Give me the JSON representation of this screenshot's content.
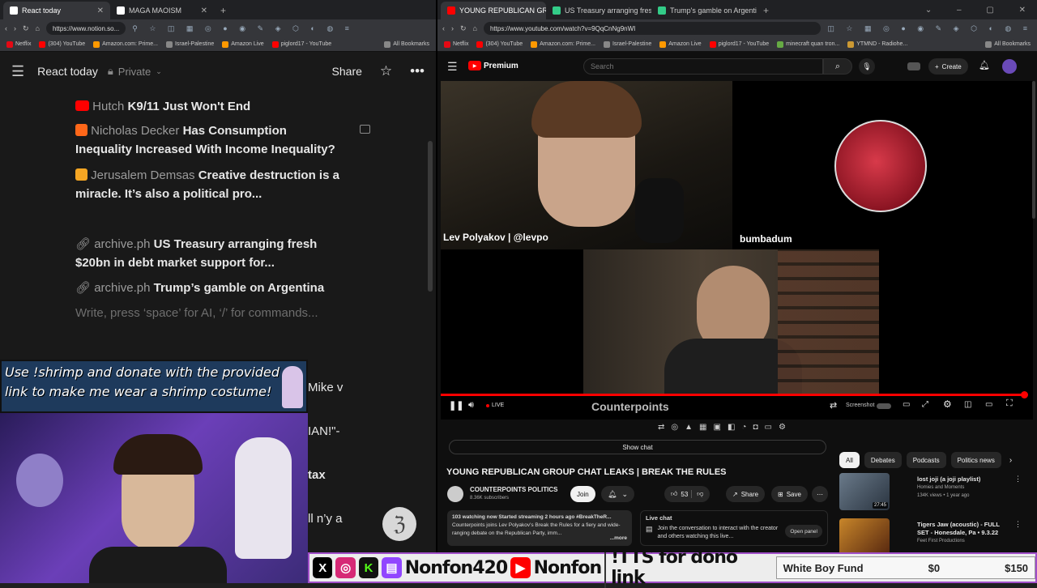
{
  "left_browser": {
    "tabs": [
      {
        "label": "React today",
        "active": true
      },
      {
        "label": "MAGA MAOISM",
        "active": false
      }
    ],
    "url": "https://www.notion.so...",
    "bookmarks": [
      "Netflix",
      "(304) YouTube",
      "Amazon.com: Prime...",
      "Israel-Palestine",
      "Amazon Live",
      "piglord17 - YouTube"
    ],
    "all_bookmarks": "All Bookmarks"
  },
  "notion": {
    "page_title": "React today",
    "privacy": "Private",
    "share_label": "Share",
    "blocks": [
      {
        "source": "Hutch",
        "title": "K9/11 Just Won't End",
        "icon": "youtube-icon"
      },
      {
        "source": "Nicholas Decker",
        "title": "Has Consumption",
        "title2": "Inequality Increased With Income Inequality?",
        "icon": "substack-icon"
      },
      {
        "source": "Jerusalem Demsas",
        "title": "Creative destruction is a",
        "title2": "miracle. It’s also a political pro...",
        "icon": "substack-icon"
      },
      {
        "source": "archive.ph",
        "title": "US Treasury arranging fresh",
        "title2": "$20bn in debt market support for...",
        "icon": "link-icon"
      },
      {
        "source": "archive.ph",
        "title": "Trump’s gamble on Argentina",
        "icon": "link-icon"
      }
    ],
    "placeholder": "Write, press ‘space’ for AI, ‘/’ for commands...",
    "obscured_fragments": [
      "Mike v",
      "IAN!\"-",
      "tax",
      "ll n’y a"
    ]
  },
  "overlay": {
    "banner_text": "Use !shrimp and donate with the provided link to make me wear a shrimp costume!",
    "socials_handle": "Nonfon420",
    "youtube_handle": "Nonfon",
    "tts_text": "!TTS for dono link",
    "fund_label": "White Boy Fund",
    "fund_current": "$0",
    "fund_goal": "$150"
  },
  "right_browser": {
    "tabs": [
      {
        "label": "YOUNG REPUBLICAN GRO...",
        "active": true
      },
      {
        "label": "US Treasury arranging fresh $2...",
        "active": false
      },
      {
        "label": "Trump's gamble on Argentina",
        "active": false
      }
    ],
    "url": "https://www.youtube.com/watch?v=9QqCnNg9nWI",
    "bookmarks": [
      "Netflix",
      "(304) YouTube",
      "Amazon.com: Prime...",
      "Israel-Palestine",
      "Amazon Live",
      "piglord17 - YouTube",
      "minecraft quan tron...",
      "YTMND - Radiohe..."
    ],
    "all_bookmarks": "All Bookmarks"
  },
  "youtube": {
    "logo_label": "Premium",
    "search_placeholder": "Search",
    "create_label": "Create",
    "participants": {
      "top_left": "Lev Polyakov | @levpo",
      "top_right": "bumbadum"
    },
    "channel_watermark": "Counterpoints",
    "live_label": "LIVE",
    "screenshot_label": "Screenshot",
    "show_chat": "Show chat",
    "video_title": "YOUNG REPUBLICAN GROUP CHAT LEAKS | BREAK THE RULES",
    "channel_name": "COUNTERPOINTS POLITICS",
    "subscribers": "8.36K subscribers",
    "join_label": "Join",
    "likes": "53",
    "share_label": "Share",
    "save_label": "Save",
    "description_meta": "103 watching now  Started streaming 2 hours ago  #BreakTheR...",
    "description_text": "Counterpoints joins Lev Polyakov's Break the Rules for a fiery and wide-ranging debate on the Republican Party, imm...",
    "more_label": "...more",
    "live_chat_title": "Live chat",
    "live_chat_text": "Join the conversation to interact with the creator and others watching this live...",
    "open_panel": "Open panel",
    "filter_chips": [
      "All",
      "Debates",
      "Podcasts",
      "Politics news"
    ],
    "recommendations": [
      {
        "title": "lost joji (a joji playlist)",
        "channel": "Homies and Moments",
        "meta": "134K views • 1 year ago",
        "duration": "27:45"
      },
      {
        "title": "Tigers Jaw (acoustic) - FULL SET - Honesdale, Pa • 9.3.22",
        "channel": "Feet First Productions",
        "meta": "",
        "duration": ""
      }
    ]
  },
  "colors": {
    "yt_red": "#ff0000",
    "notion_bg": "#191919",
    "twitch_purple": "#9146ff",
    "kick_green": "#53fc18"
  }
}
